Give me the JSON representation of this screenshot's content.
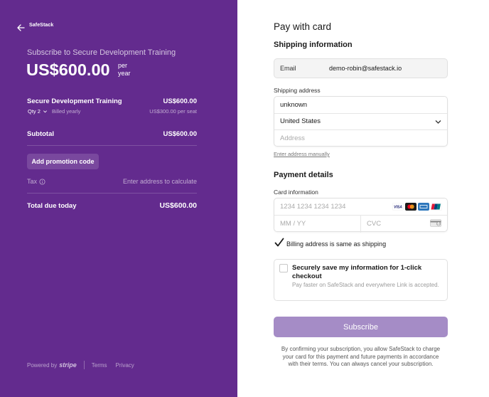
{
  "left_panel": {
    "background_color": "#632b8e",
    "brand": "SafeStack",
    "subscribe_title": "Subscribe to Secure Development Training",
    "price": "US$600.00",
    "price_per_line1": "per",
    "price_per_line2": "year",
    "line_item": {
      "name": "Secure Development Training",
      "price": "US$600.00",
      "qty_label": "Qty 2",
      "billed": "Billed yearly",
      "unit_price": "US$300.00 per seat"
    },
    "subtotal_label": "Subtotal",
    "subtotal_value": "US$600.00",
    "promo_button": "Add promotion code",
    "tax_label": "Tax",
    "tax_value": "Enter address to calculate",
    "total_label": "Total due today",
    "total_value": "US$600.00",
    "footer": {
      "powered_by": "Powered by",
      "stripe": "stripe",
      "terms": "Terms",
      "privacy": "Privacy"
    }
  },
  "form": {
    "heading": "Pay with card",
    "shipping_heading": "Shipping information",
    "email_label": "Email",
    "email_value": "demo-robin@safestack.io",
    "shipping_address_label": "Shipping address",
    "name_value": "unknown",
    "country_value": "United States",
    "address_placeholder": "Address",
    "manual_link": "Enter address manually",
    "payment_heading": "Payment details",
    "card_info_label": "Card information",
    "card_number_placeholder": "1234 1234 1234 1234",
    "expiry_placeholder": "MM / YY",
    "cvc_placeholder": "CVC",
    "card_brands": [
      "visa-icon",
      "mastercard-icon",
      "amex-icon",
      "unionpay-icon"
    ],
    "billing_same_checked": true,
    "billing_same_label": "Billing address is same as shipping",
    "save_info_checked": false,
    "save_info_title": "Securely save my information for 1-click checkout",
    "save_info_desc": "Pay faster on SafeStack and everywhere Link is accepted.",
    "subscribe_button": "Subscribe",
    "subscribe_button_color": "#a58cc6",
    "legal_text": "By confirming your subscription, you allow SafeStack to charge your card for this payment and future payments in accordance with their terms. You can always cancel your subscription."
  }
}
